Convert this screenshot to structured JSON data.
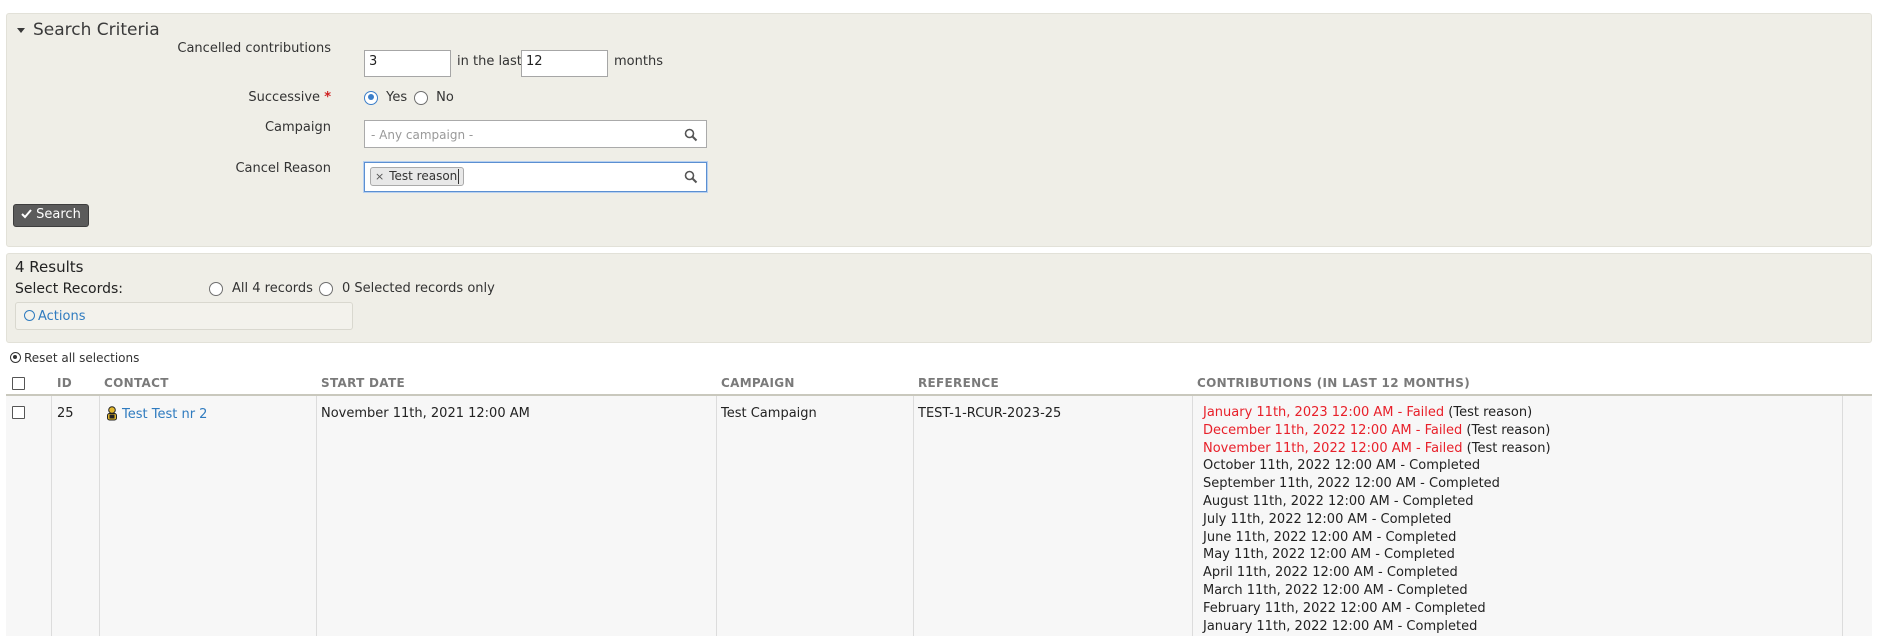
{
  "criteria": {
    "title": "Search Criteria",
    "cancelled_label": "Cancelled contributions",
    "cancelled_value": "3",
    "in_the_last": "in the last",
    "months_value": "12",
    "months_label": "months",
    "successive_label": "Successive",
    "required_mark": "*",
    "successive_yes": "Yes",
    "successive_no": "No",
    "campaign_label": "Campaign",
    "campaign_placeholder": "- Any campaign -",
    "cancel_reason_label": "Cancel Reason",
    "cancel_reason_tag": "Test reason",
    "cancel_reason_tag_remove": "×",
    "search_button": "Search"
  },
  "results": {
    "count": "4 Results",
    "select_records": "Select Records:",
    "all_records": "All 4 records",
    "selected_only": "0 Selected records only",
    "actions": "Actions",
    "reset": "Reset all selections"
  },
  "table": {
    "headers": {
      "id": "ID",
      "contact": "CONTACT",
      "start_date": "START DATE",
      "campaign": "CAMPAIGN",
      "reference": "REFERENCE",
      "contributions": "CONTRIBUTIONS (IN LAST 12 MONTHS)"
    },
    "rows": [
      {
        "id": "25",
        "contact": "Test Test nr 2",
        "start_date": "November 11th, 2021 12:00 AM",
        "campaign": "Test Campaign",
        "reference": "TEST-1-RCUR-2023-25",
        "contributions": [
          {
            "text": "January 11th, 2023 12:00 AM - Failed",
            "reason": " (Test reason)",
            "status": "failed"
          },
          {
            "text": "December 11th, 2022 12:00 AM - Failed",
            "reason": " (Test reason)",
            "status": "failed"
          },
          {
            "text": "November 11th, 2022 12:00 AM - Failed",
            "reason": " (Test reason)",
            "status": "failed"
          },
          {
            "text": "October 11th, 2022 12:00 AM - Completed",
            "reason": "",
            "status": "completed"
          },
          {
            "text": "September 11th, 2022 12:00 AM - Completed",
            "reason": "",
            "status": "completed"
          },
          {
            "text": "August 11th, 2022 12:00 AM - Completed",
            "reason": "",
            "status": "completed"
          },
          {
            "text": "July 11th, 2022 12:00 AM - Completed",
            "reason": "",
            "status": "completed"
          },
          {
            "text": "June 11th, 2022 12:00 AM - Completed",
            "reason": "",
            "status": "completed"
          },
          {
            "text": "May 11th, 2022 12:00 AM - Completed",
            "reason": "",
            "status": "completed"
          },
          {
            "text": "April 11th, 2022 12:00 AM - Completed",
            "reason": "",
            "status": "completed"
          },
          {
            "text": "March 11th, 2022 12:00 AM - Completed",
            "reason": "",
            "status": "completed"
          },
          {
            "text": "February 11th, 2022 12:00 AM - Completed",
            "reason": "",
            "status": "completed"
          },
          {
            "text": "January 11th, 2022 12:00 AM - Completed",
            "reason": "",
            "status": "completed"
          }
        ]
      }
    ]
  },
  "colors": {
    "panel_bg": "#efeee7",
    "link": "#2f7bbf",
    "failed": "#e8202a",
    "button_bg": "#5b5b5b"
  },
  "icons": {
    "collapse": "caret-down-icon",
    "search": "magnifier-icon",
    "check": "check-icon",
    "actions": "circle-chevron-icon",
    "reset": "radio-dot-icon",
    "contact_type": "individual-contact-icon"
  }
}
